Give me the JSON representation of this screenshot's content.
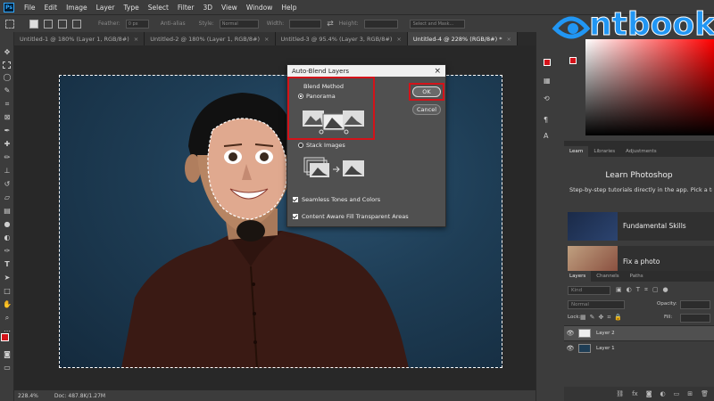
{
  "menu": [
    "File",
    "Edit",
    "Image",
    "Layer",
    "Type",
    "Select",
    "Filter",
    "3D",
    "View",
    "Window",
    "Help"
  ],
  "app_icon_label": "Ps",
  "options": {
    "feather_label": "Feather:",
    "feather_value": "0 px",
    "antialias_label": "Anti-alias",
    "style_label": "Style:",
    "style_value": "Normal",
    "width_label": "Width:",
    "height_label": "Height:",
    "select_mask": "Select and Mask..."
  },
  "tabs": [
    {
      "label": "Untitled-1 @ 180% (Layer 1, RGB/8#)",
      "close": "×",
      "active": false
    },
    {
      "label": "Untitled-2 @ 180% (Layer 1, RGB/8#)",
      "close": "×",
      "active": false
    },
    {
      "label": "Untitled-3 @ 95.4% (Layer 3, RGB/8#)",
      "close": "×",
      "active": false
    },
    {
      "label": "Untitled-4 @ 228% (RGB/8#) *",
      "close": "×",
      "active": true
    }
  ],
  "status": {
    "zoom": "228.4%",
    "doc": "Doc: 487.8K/1.27M"
  },
  "dialog": {
    "title": "Auto-Blend Layers",
    "close": "×",
    "blend_method": "Blend Method",
    "panorama": "Panorama",
    "stack_images": "Stack Images",
    "seamless": "Seamless Tones and Colors",
    "content_aware": "Content Aware Fill Transparent Areas",
    "ok": "OK",
    "cancel": "Cancel",
    "panorama_selected": true,
    "seamless_checked": true,
    "content_aware_checked": true
  },
  "watermark": "ntbook",
  "panels": {
    "learn_tabs": [
      "Learn",
      "Libraries",
      "Adjustments"
    ],
    "learn_title": "Learn Photoshop",
    "learn_desc": "Step-by-step tutorials directly in the app. Pick a topic below to begin.",
    "cards": [
      {
        "label": "Fundamental Skills"
      },
      {
        "label": "Fix a photo"
      }
    ],
    "layers_tabs": [
      "Layers",
      "Channels",
      "Paths"
    ],
    "kind_placeholder": "Kind",
    "blend_mode": "Normal",
    "opacity_label": "Opacity:",
    "lock_label": "Lock:",
    "fill_label": "Fill:",
    "layers": [
      {
        "name": "Layer 2",
        "selected": true
      },
      {
        "name": "Layer 1",
        "selected": false
      }
    ]
  },
  "colors": {
    "foreground": "#d3131a",
    "background": "#ffffff",
    "accent": "#d3131a",
    "watermark": "#2196f3"
  }
}
